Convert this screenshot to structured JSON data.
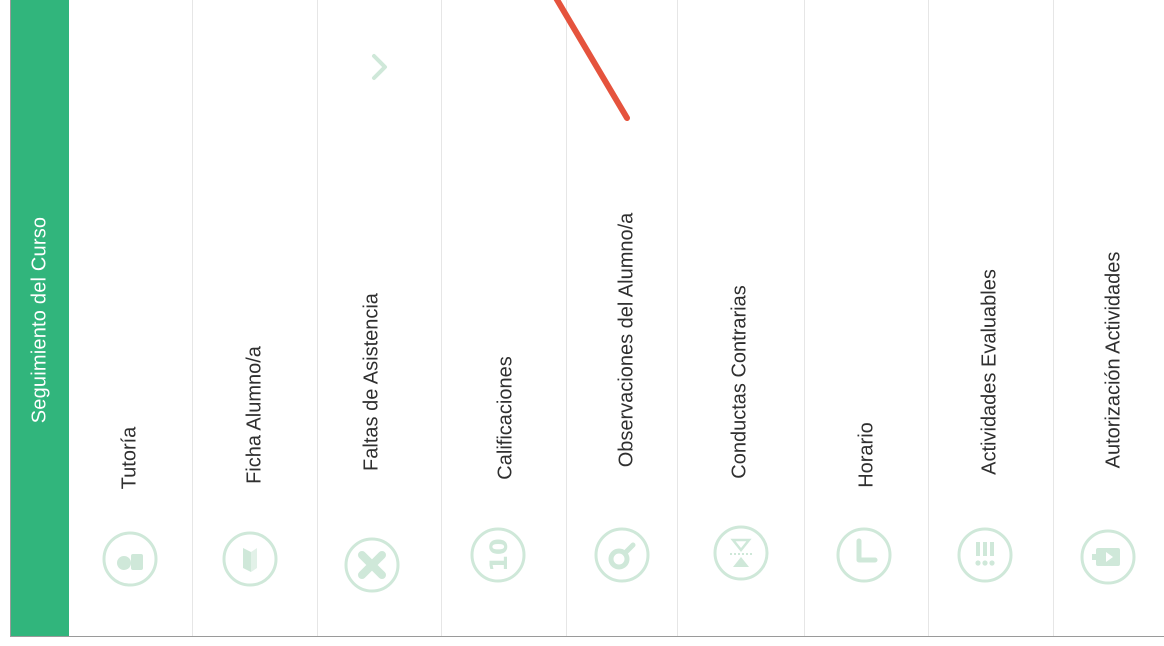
{
  "sidebar": {
    "title": "Seguimiento del Curso"
  },
  "menu": {
    "items": [
      {
        "label": "Tutoría",
        "icon": "tutoria-icon"
      },
      {
        "label": "Ficha Alumno/a",
        "icon": "ficha-icon"
      },
      {
        "label": "Faltas de Asistencia",
        "icon": "faltas-icon"
      },
      {
        "label": "Calificaciones",
        "icon": "calificaciones-icon"
      },
      {
        "label": "Observaciones del Alumno/a",
        "icon": "observaciones-icon"
      },
      {
        "label": "Conductas Contrarias",
        "icon": "conductas-icon"
      },
      {
        "label": "Horario",
        "icon": "horario-icon"
      },
      {
        "label": "Actividades Evaluables",
        "icon": "actividades-icon"
      },
      {
        "label": "Autorización Actividades",
        "icon": "autorizacion-icon"
      }
    ]
  },
  "colors": {
    "accent": "#31b57c",
    "icon": "#cfe8d9",
    "annotation": "#e5533d"
  }
}
